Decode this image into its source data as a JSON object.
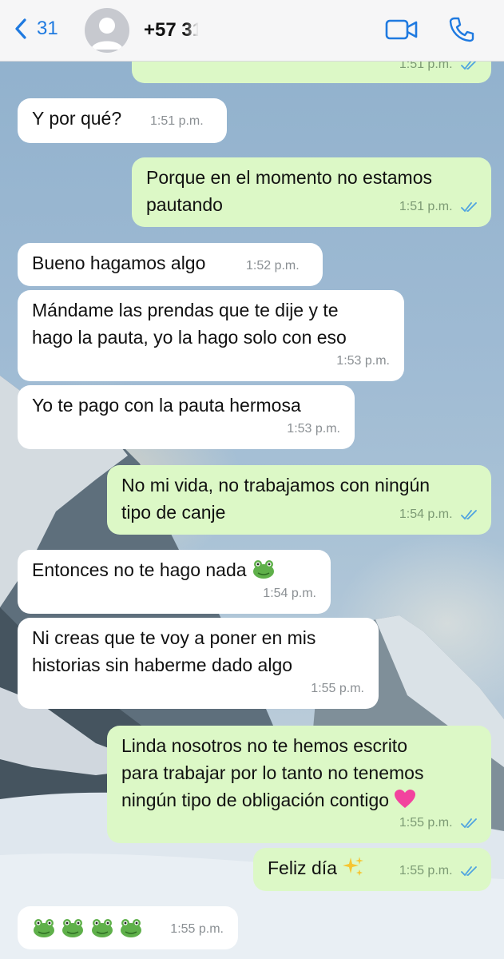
{
  "header": {
    "back_label": "31",
    "contact_name": "+57 31",
    "icons": [
      "chevron-left-icon",
      "avatar-placeholder-icon",
      "video-call-icon",
      "phone-call-icon"
    ]
  },
  "colors": {
    "header_bg": "#f6f6f7",
    "accent": "#1f7ae0",
    "incoming_bubble": "#ffffff",
    "outgoing_bubble": "#dcf8c6",
    "read_tick": "#4fa3e0"
  },
  "messages": [
    {
      "direction": "out",
      "text": "",
      "time": "1:51 p.m.",
      "read": true
    },
    {
      "direction": "in",
      "text": "Y por qué?",
      "time": "1:51 p.m."
    },
    {
      "direction": "out",
      "text_line1": "Porque en el momento no estamos",
      "text_line2": "pautando",
      "time": "1:51 p.m.",
      "read": true
    },
    {
      "direction": "in",
      "text": "Bueno hagamos algo",
      "time": "1:52 p.m."
    },
    {
      "direction": "in",
      "text_line1": "Mándame las prendas que te dije y te",
      "text_line2": "hago la pauta, yo la hago solo con eso",
      "time": "1:53 p.m."
    },
    {
      "direction": "in",
      "text": "Yo te pago con la pauta hermosa",
      "time": "1:53 p.m."
    },
    {
      "direction": "out",
      "text_line1": "No mi vida, no trabajamos con ningún",
      "text_line2": "tipo de canje",
      "time": "1:54 p.m.",
      "read": true
    },
    {
      "direction": "in",
      "text": "Entonces no te hago nada",
      "emoji": "frog-emoji",
      "time": "1:54 p.m."
    },
    {
      "direction": "in",
      "text_line1": "Ni creas que te voy a poner en mis",
      "text_line2": "historias sin haberme dado algo",
      "time": "1:55 p.m."
    },
    {
      "direction": "out",
      "text_line1": "Linda nosotros no te hemos escrito",
      "text_line2": "para trabajar por lo tanto no tenemos",
      "text_line3": "ningún tipo de obligación contigo",
      "emoji": "pink-heart-emoji",
      "time": "1:55 p.m.",
      "read": true
    },
    {
      "direction": "out",
      "text": "Feliz día",
      "emoji": "sparkles-emoji",
      "time": "1:55 p.m.",
      "read": true
    },
    {
      "direction": "in",
      "text": "",
      "emoji": "frog-emoji-x4",
      "time": "1:55 p.m."
    }
  ]
}
